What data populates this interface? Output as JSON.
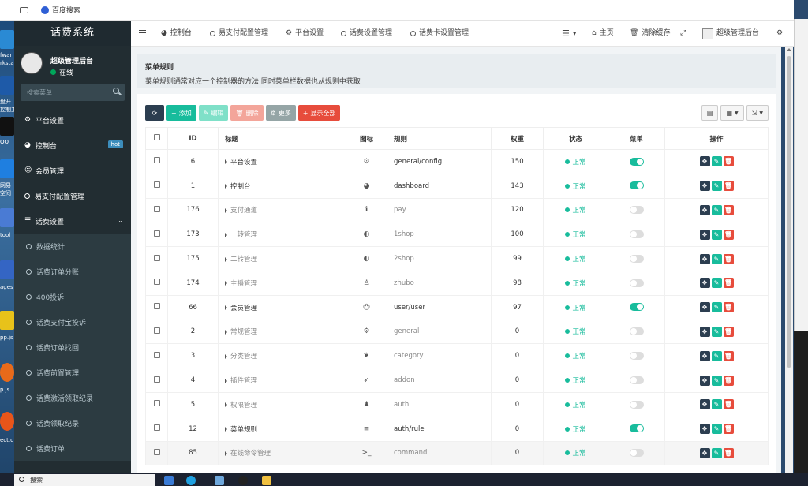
{
  "browser": {
    "tab_title": "百度搜索"
  },
  "desktop_labels": [
    "fwar",
    "rksta",
    "盘开",
    "控制工",
    "QQ",
    "网易",
    "空间",
    "tool",
    "ages",
    "pp.js",
    "p.js",
    "ect.c"
  ],
  "sidebar": {
    "logo": "话费系统",
    "user_name": "超级管理后台",
    "user_status": "在线",
    "search_placeholder": "搜索菜单",
    "items": [
      {
        "label": "平台设置",
        "icon": "gear-icon"
      },
      {
        "label": "控制台",
        "icon": "dashboard-icon",
        "badge": "hot"
      },
      {
        "label": "会员管理",
        "icon": "user-icon"
      },
      {
        "label": "易支付配置管理",
        "icon": "circle-icon"
      },
      {
        "label": "话费设置",
        "icon": "list-icon"
      }
    ],
    "sub_items": [
      "数据统计",
      "话费订单分账",
      "400投诉",
      "话费支付宝投诉",
      "话费订单找回",
      "话费前置管理",
      "话费激活领取纪录",
      "话费领取纪录",
      "话费订单"
    ]
  },
  "topbar": {
    "tabs": [
      "控制台",
      "易支付配置管理",
      "平台设置",
      "话费设置管理",
      "话费卡设置管理"
    ],
    "home": "主页",
    "clear_cache": "清除缓存",
    "admin": "超级管理后台"
  },
  "panel": {
    "title": "菜单规则",
    "description": "菜单规则通常对应一个控制器的方法,同时菜单栏数据也从规则中获取"
  },
  "toolbar": {
    "add": "添加",
    "edit": "编辑",
    "delete": "删除",
    "more": "更多",
    "show_all": "显示全部"
  },
  "table": {
    "headers": [
      "ID",
      "标题",
      "图标",
      "规则",
      "权重",
      "状态",
      "菜单",
      "操作"
    ],
    "rows": [
      {
        "id": "6",
        "title": "平台设置",
        "icon": "⚙",
        "rule": "general/config",
        "weight": "150",
        "status": "正常",
        "menu": true
      },
      {
        "id": "1",
        "title": "控制台",
        "icon": "◕",
        "rule": "dashboard",
        "weight": "143",
        "status": "正常",
        "menu": true
      },
      {
        "id": "176",
        "title": "支付通道",
        "icon": "ℹ",
        "rule": "pay",
        "weight": "120",
        "status": "正常",
        "menu": false
      },
      {
        "id": "173",
        "title": "一转管理",
        "icon": "◐",
        "rule": "1shop",
        "weight": "100",
        "status": "正常",
        "menu": false
      },
      {
        "id": "175",
        "title": "二转管理",
        "icon": "◐",
        "rule": "2shop",
        "weight": "99",
        "status": "正常",
        "menu": false
      },
      {
        "id": "174",
        "title": "主播管理",
        "icon": "♙",
        "rule": "zhubo",
        "weight": "98",
        "status": "正常",
        "menu": false
      },
      {
        "id": "66",
        "title": "会员管理",
        "icon": "☺",
        "rule": "user/user",
        "weight": "97",
        "status": "正常",
        "menu": true
      },
      {
        "id": "2",
        "title": "常规管理",
        "icon": "⚙",
        "rule": "general",
        "weight": "0",
        "status": "正常",
        "menu": false
      },
      {
        "id": "3",
        "title": "分类管理",
        "icon": "❦",
        "rule": "category",
        "weight": "0",
        "status": "正常",
        "menu": false
      },
      {
        "id": "4",
        "title": "插件管理",
        "icon": "➶",
        "rule": "addon",
        "weight": "0",
        "status": "正常",
        "menu": false
      },
      {
        "id": "5",
        "title": "权限管理",
        "icon": "♟",
        "rule": "auth",
        "weight": "0",
        "status": "正常",
        "menu": false
      },
      {
        "id": "12",
        "title": "菜单规则",
        "icon": "≡",
        "rule": "auth/rule",
        "weight": "0",
        "status": "正常",
        "menu": true
      },
      {
        "id": "85",
        "title": "在线命令管理",
        "icon": ">_",
        "rule": "command",
        "weight": "0",
        "status": "正常",
        "menu": false
      }
    ]
  },
  "taskbar": {
    "search_placeholder": "搜索"
  }
}
